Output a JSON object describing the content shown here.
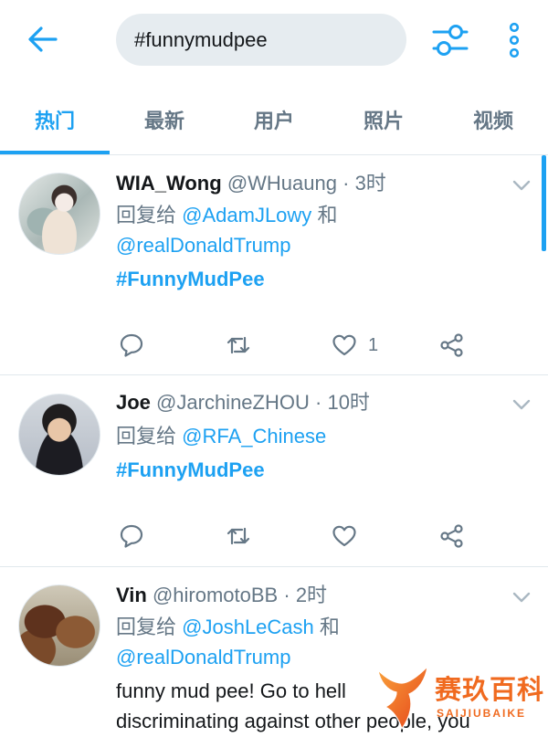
{
  "header": {
    "search_value": "#funnymudpee",
    "icons": {
      "back": "back-arrow-icon",
      "filter": "sliders-icon",
      "more": "more-vertical-icon"
    }
  },
  "tabs": [
    {
      "label": "热门",
      "active": true
    },
    {
      "label": "最新",
      "active": false
    },
    {
      "label": "用户",
      "active": false
    },
    {
      "label": "照片",
      "active": false
    },
    {
      "label": "视频",
      "active": false
    }
  ],
  "tweets": [
    {
      "name": "WIA_Wong",
      "handle": "@WHuaung",
      "separator": "·",
      "time": "3时",
      "reply_prefix": "回复给",
      "reply_to": [
        "@AdamJLowy",
        "@realDonaldTrump"
      ],
      "reply_conj": "和",
      "hashtag": "#FunnyMudPee",
      "like_count": "1"
    },
    {
      "name": "Joe",
      "handle": "@JarchineZHOU",
      "separator": "·",
      "time": "10时",
      "reply_prefix": "回复给",
      "reply_to": [
        "@RFA_Chinese"
      ],
      "hashtag": "#FunnyMudPee"
    },
    {
      "name": "Vin",
      "handle": "@hiromotoBB",
      "separator": "·",
      "time": "2时",
      "reply_prefix": "回复给",
      "reply_to": [
        "@JoshLeCash",
        "@realDonaldTrump"
      ],
      "reply_conj": "和",
      "text_lines": [
        "funny mud pee! Go to hell",
        "discriminating against other people, you"
      ]
    }
  ],
  "action_icons": [
    "reply-icon",
    "retweet-icon",
    "like-icon",
    "share-icon"
  ],
  "watermark": {
    "name": "赛玖百科",
    "latin": "SAIJIUBAIKE"
  },
  "colors": {
    "accent": "#1DA1F2",
    "text": "#14171A",
    "muted": "#657786",
    "divider": "#E1E8ED",
    "search_bg": "#E6ECF0",
    "watermark": "#F06A1F"
  }
}
